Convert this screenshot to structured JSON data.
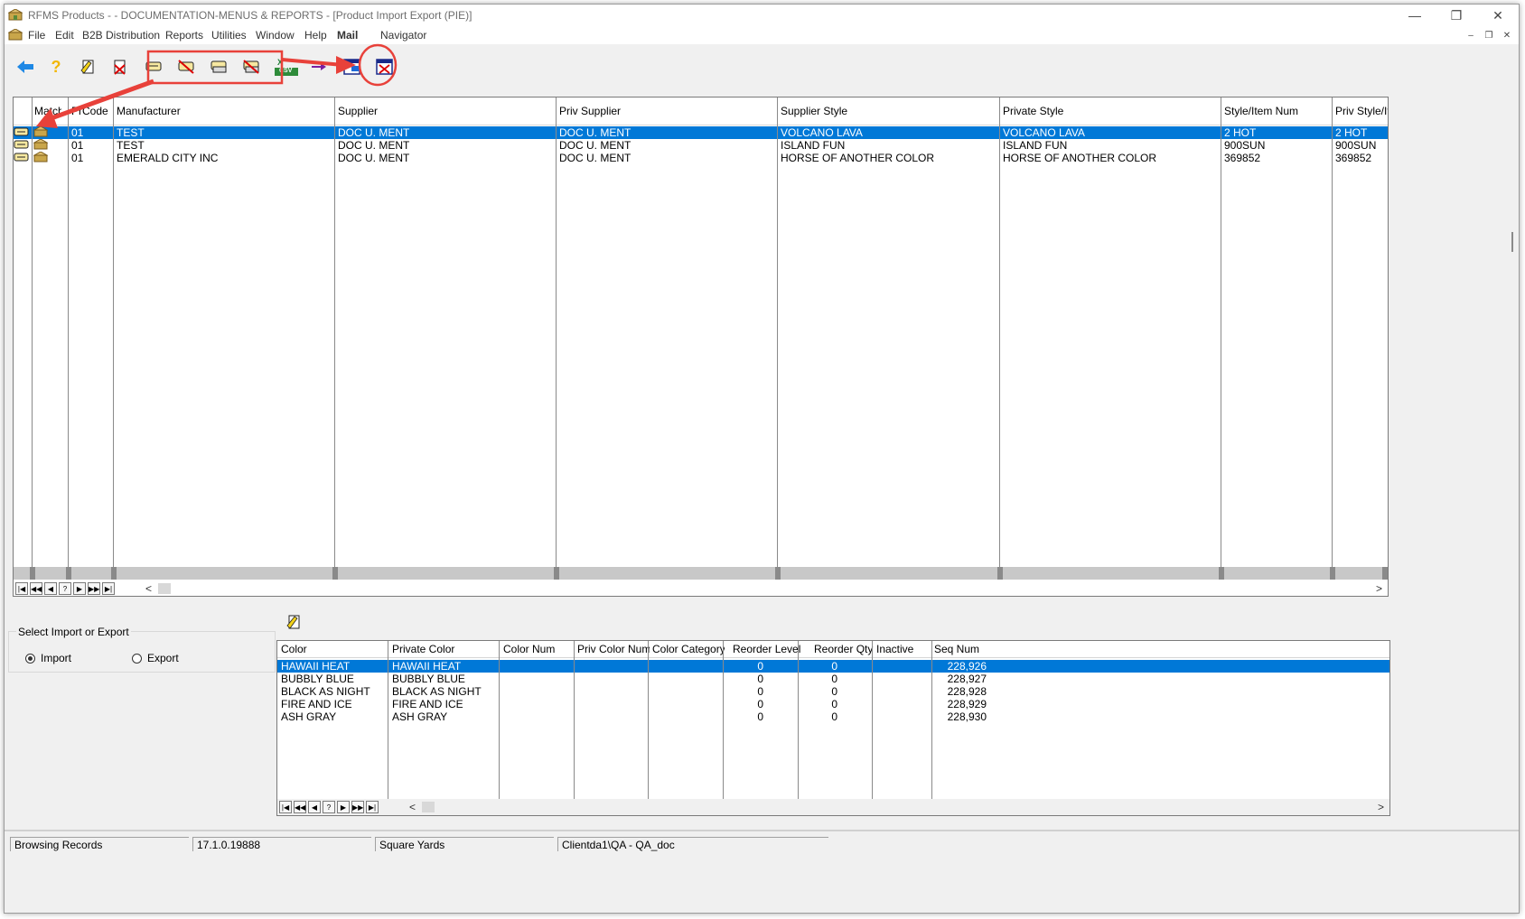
{
  "window": {
    "title": "RFMS Products - - DOCUMENTATION-MENUS & REPORTS - [Product Import Export (PIE)]",
    "controls": {
      "minimize": "—",
      "restore": "❐",
      "close": "✕"
    }
  },
  "menu": {
    "items": [
      "File",
      "Edit",
      "B2B Distribution",
      "Reports",
      "Utilities",
      "Window",
      "Help",
      "Mail",
      "Navigator"
    ],
    "mdi_controls": [
      "–",
      "❐",
      "✕"
    ]
  },
  "toolbar": {
    "csv_label": "CSV",
    "help_glyph": "?",
    "buttons": [
      "back-arrow",
      "help",
      "add-record",
      "delete-record",
      "tag-import",
      "tag-remove",
      "tag-edit",
      "tag-delete",
      "excel-csv",
      "merge-arrow",
      "export-window",
      "close-window"
    ]
  },
  "products_grid": {
    "headers": [
      "",
      "Match",
      "PrCode",
      "Manufacturer",
      "Supplier",
      "Priv Supplier",
      "Supplier Style",
      "Private Style",
      "Style/Item Num",
      "Priv Style/It"
    ],
    "rows": [
      {
        "prcode": "01",
        "manufacturer": "TEST",
        "supplier": "DOC U. MENT",
        "priv_supplier": "DOC U. MENT",
        "supplier_style": "VOLCANO LAVA",
        "private_style": "VOLCANO LAVA",
        "style_num": "2 HOT",
        "priv_style_num": "2 HOT",
        "selected": true
      },
      {
        "prcode": "01",
        "manufacturer": "TEST",
        "supplier": "DOC U. MENT",
        "priv_supplier": "DOC U. MENT",
        "supplier_style": "ISLAND FUN",
        "private_style": "ISLAND FUN",
        "style_num": "900SUN",
        "priv_style_num": "900SUN",
        "selected": false
      },
      {
        "prcode": "01",
        "manufacturer": "EMERALD CITY INC",
        "supplier": "DOC U. MENT",
        "priv_supplier": "DOC U. MENT",
        "supplier_style": "HORSE OF ANOTHER COLOR",
        "private_style": "HORSE OF ANOTHER COLOR",
        "style_num": "369852",
        "priv_style_num": "369852",
        "selected": false
      }
    ]
  },
  "nav_buttons": [
    "|◀",
    "◀◀",
    "◀",
    "?",
    "▶",
    "▶▶",
    "▶|"
  ],
  "scroll": {
    "left": "<",
    "right": ">"
  },
  "import_export": {
    "legend": "Select Import or Export",
    "options": [
      "Import",
      "Export"
    ],
    "selected": "Import"
  },
  "colors_grid": {
    "headers": [
      "Color",
      "Private Color",
      "Color Num",
      "Priv Color Num",
      "Color Category",
      "Reorder Level",
      "Reorder Qty",
      "Inactive",
      "Seq Num"
    ],
    "rows": [
      {
        "color": "HAWAII HEAT",
        "private_color": "HAWAII HEAT",
        "reorder_level": "0",
        "reorder_qty": "0",
        "seq": "228,926",
        "selected": true
      },
      {
        "color": "BUBBLY BLUE",
        "private_color": "BUBBLY BLUE",
        "reorder_level": "0",
        "reorder_qty": "0",
        "seq": "228,927",
        "selected": false
      },
      {
        "color": "BLACK AS NIGHT",
        "private_color": "BLACK AS NIGHT",
        "reorder_level": "0",
        "reorder_qty": "0",
        "seq": "228,928",
        "selected": false
      },
      {
        "color": "FIRE AND ICE",
        "private_color": "FIRE AND ICE",
        "reorder_level": "0",
        "reorder_qty": "0",
        "seq": "228,929",
        "selected": false
      },
      {
        "color": "ASH GRAY",
        "private_color": "ASH GRAY",
        "reorder_level": "0",
        "reorder_qty": "0",
        "seq": "228,930",
        "selected": false
      }
    ]
  },
  "status": {
    "mode": "Browsing Records",
    "version": "17.1.0.19888",
    "unit": "Square Yards",
    "client": "Clientda1\\QA - QA_doc"
  },
  "colors": {
    "selection": "#0078d7",
    "annotation": "#e8413a",
    "back_arrow": "#1e88e5",
    "help": "#f2b705"
  }
}
